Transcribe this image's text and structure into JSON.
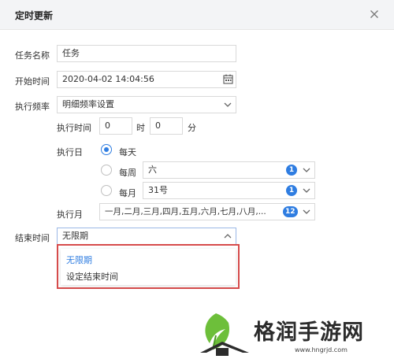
{
  "dialog": {
    "title": "定时更新",
    "close_icon": "close-icon"
  },
  "form": {
    "task_name": {
      "label": "任务名称",
      "value": "任务"
    },
    "start_time": {
      "label": "开始时间",
      "value": "2020-04-02 14:04:56",
      "icon": "calendar-icon"
    },
    "frequency": {
      "label": "执行频率",
      "value": "明细频率设置"
    },
    "exec_time": {
      "label": "执行时间",
      "hour_value": "0",
      "hour_unit": "时",
      "minute_value": "0",
      "minute_unit": "分"
    },
    "exec_day": {
      "label": "执行日",
      "daily": {
        "label": "每天",
        "checked": true
      },
      "weekly": {
        "label": "每周",
        "value": "六",
        "count": "1"
      },
      "monthly": {
        "label": "每月",
        "value": "31号",
        "count": "1"
      }
    },
    "exec_month": {
      "label": "执行月",
      "value": "一月,二月,三月,四月,五月,六月,七月,八月,...",
      "count": "12"
    },
    "end_time": {
      "label": "结束时间",
      "value": "无限期",
      "options": [
        "无限期",
        "设定结束时间"
      ],
      "selected_index": 0
    }
  },
  "watermark": {
    "text": "格润手游网",
    "url": "www.hngrjd.com"
  },
  "colors": {
    "accent": "#2f7de1",
    "highlight_border": "#d64b4b",
    "header_bg": "#f3f4f6"
  }
}
